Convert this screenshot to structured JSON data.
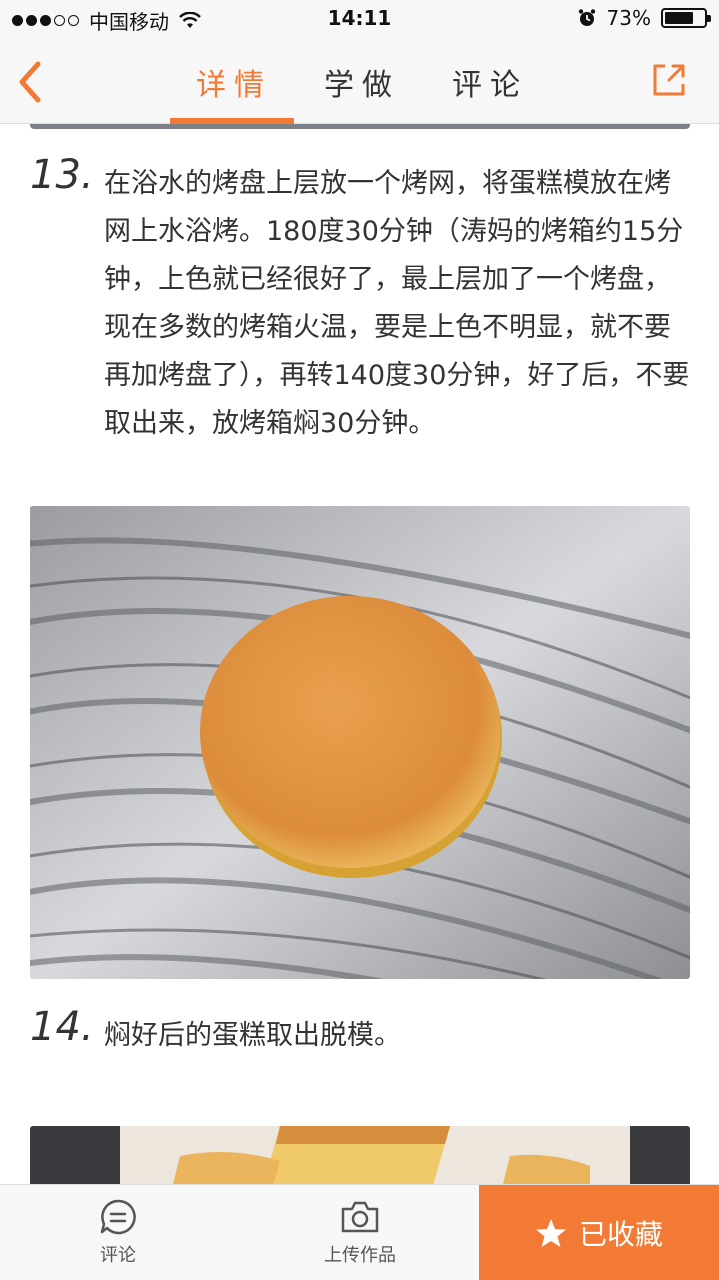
{
  "status_bar": {
    "carrier": "中国移动",
    "time": "14:11",
    "battery_percent": "73%",
    "battery_level": 0.73
  },
  "nav": {
    "tabs": [
      {
        "label": "详情",
        "active": true
      },
      {
        "label": "学做",
        "active": false
      },
      {
        "label": "评论",
        "active": false
      }
    ],
    "back_icon": "chevron-left-icon",
    "share_icon": "share-external-icon"
  },
  "steps": [
    {
      "number": "13.",
      "text": "在浴水的烤盘上层放一个烤网，将蛋糕模放在烤网上水浴烤。180度30分钟（涛妈的烤箱约15分钟，上色就已经很好了，最上层加了一个烤盘，现在多数的烤箱火温，要是上色不明显，就不要再加烤盘了），再转140度30分钟，好了后，不要取出来，放烤箱焖30分钟。"
    },
    {
      "number": "14.",
      "text": "焖好后的蛋糕取出脱模。"
    }
  ],
  "bottom_bar": {
    "comment_label": "评论",
    "upload_label": "上传作品",
    "favorite_label": "已收藏"
  },
  "colors": {
    "accent": "#f27a35",
    "text": "#333333",
    "bar_bg": "#f7f7f7"
  }
}
